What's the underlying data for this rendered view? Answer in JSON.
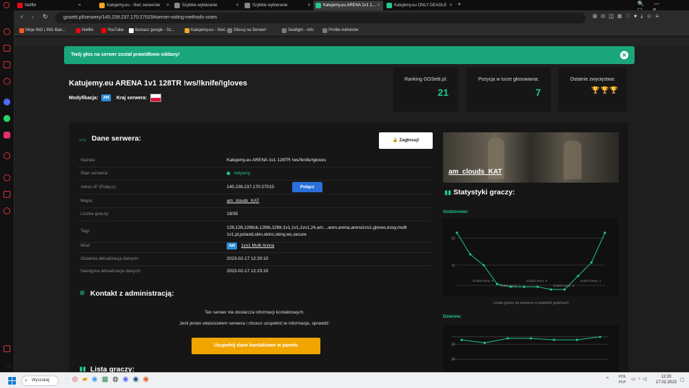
{
  "browser": {
    "tabs": [
      {
        "title": "Netflix",
        "color": "#e50914"
      },
      {
        "title": "Katujemy.eu - Sieć serwerów",
        "color": "#f5a623"
      },
      {
        "title": "Szybkie wybieranie",
        "color": "#888888"
      },
      {
        "title": "Szybkie wybieranie",
        "color": "#888888"
      },
      {
        "title": "Katujemy.eu ARENA 1v1 1...",
        "color": "#1fc991",
        "active": true
      },
      {
        "title": "Katujemy.eu ONLY DEAGLE",
        "color": "#1fc991"
      }
    ],
    "new_tab": "+",
    "url": "gosetti.pl/serwery/145.239.237.170:27015#server-voting-methods-votes",
    "bookmarks": [
      "Moje ING | ING Ban...",
      "Netflix",
      "YouTube",
      "tlumacz google - Sz...",
      "Katujemy.eu - Sieć...",
      "Głosuj na Serwer!",
      "Seafight - info",
      "Profile Adminów"
    ]
  },
  "alert": {
    "text": "Twój głos na serwer został prawidłowo oddany!"
  },
  "server": {
    "title": "Katujemy.eu ARENA 1v1 128TR !ws/!knife/!gloves",
    "mod_label": "Modyfikacja:",
    "mod_badge": "AM",
    "country_label": "Kraj serwera:"
  },
  "stats": [
    {
      "label": "Ranking GOSetti.pl:",
      "value": "21"
    },
    {
      "label": "Pozycja w turze głosowania:",
      "value": "7"
    },
    {
      "label": "Ostatnie zwycięstwa:",
      "value": ""
    }
  ],
  "details": {
    "title": "Dane serwera:",
    "vote_button": "Zagłosuj!",
    "rows": [
      {
        "label": "Nazwa:",
        "value": "Katujemy.eu ARENA 1v1 128TR !ws/!knife/!gloves"
      },
      {
        "label": "Stan serwera:",
        "value": "Aktywny"
      },
      {
        "label": "Adres IP (Połącz):",
        "value": "145.239.237.170:27015"
      },
      {
        "label": "Mapa:",
        "value": "am_clouds_KAT"
      },
      {
        "label": "Liczba graczy:",
        "value": "19/35"
      },
      {
        "label": "Tagi:",
        "value": "128,128,128tick,128tk,128tr,1v1,1v1,1vs1,24,am...,aren,arena,arena1vs1,gloves,kosy,multi 1v1,pl,poland,skin,skins,skiny,ws,secure"
      },
      {
        "label": "Mod:",
        "value": "1vs1 Multi Arena"
      },
      {
        "label": "Ostatnia aktualizacja danych:",
        "value": "2023-02-17 12:20:10"
      },
      {
        "label": "Następna aktualizacja danych:",
        "value": "2023-02-17 12:23:10"
      }
    ],
    "connect_button": "Połącz",
    "mod_badge": "AM"
  },
  "contact": {
    "title": "Kontakt z administracją:",
    "line1": "Ten serwer nie dostarcza informacji kontaktowych.",
    "line2": "Jeśli jesteś właścicielem serwera i chcesz uzupełnić te informacje, sprawdź:",
    "button": "Uzupełnij dane kontaktowe w panelu"
  },
  "players": {
    "title": "Lista graczy:"
  },
  "map": {
    "name": "am_clouds_KAT"
  },
  "player_stats": {
    "title": "Statystyki graczy:",
    "hourly_label": "Godzinowe:",
    "daily_label": "Dzienne:",
    "hourly_caption": "Liczba graczy na serwerze w ostatnich godzinach",
    "hourly_ticks": [
      "Godzin temu: 9",
      "Godzin temu: 7",
      "Godzin temu: 5",
      "Godzin temu: 3",
      "Godzin temu: 1"
    ],
    "hourly_y_ticks": [
      "20",
      "10"
    ],
    "daily_y_ticks": [
      "30",
      "20"
    ]
  },
  "chart_data": [
    {
      "type": "line",
      "title": "Godzinowe:",
      "xlabel": "Liczba graczy na serwerze w ostatnich godzinach",
      "ylabel": "",
      "ylim": [
        0,
        25
      ],
      "x": [
        12,
        11,
        10,
        9,
        8,
        7,
        6,
        5,
        4,
        3,
        2,
        1,
        0
      ],
      "values": [
        22,
        14,
        10,
        3,
        2,
        2,
        2,
        1,
        1,
        6,
        11,
        22
      ],
      "color": "#1fc991"
    },
    {
      "type": "line",
      "title": "Dzienne:",
      "ylabel": "",
      "ylim": [
        15,
        40
      ],
      "values": [
        33,
        31,
        34,
        34,
        33,
        33,
        35
      ],
      "color": "#1fc991"
    }
  ],
  "taskbar": {
    "search": "Wyszukaj",
    "lang1": "POL",
    "lang2": "PLP",
    "time": "12:20",
    "date": "17.02.2023"
  }
}
